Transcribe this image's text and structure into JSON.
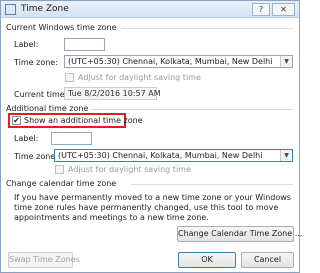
{
  "window": {
    "title": "Time Zone",
    "help_label": "?",
    "close_label": "✕"
  },
  "current": {
    "group_title": "Current Windows time zone",
    "label_label": "Label:",
    "label_value": "",
    "timezone_label": "Time zone:",
    "timezone_value": "(UTC+05:30) Chennai, Kolkata, Mumbai, New Delhi",
    "daylight_label": "Adjust for daylight saving time",
    "current_time_label": "Current time:",
    "current_time_value": "Tue 8/2/2016 10:57 AM"
  },
  "additional": {
    "group_title": "Additional time zone",
    "show_label": "Show an additional time zone",
    "show_checked": true,
    "label_label": "Label:",
    "label_value": "",
    "timezone_label": "Time zone:",
    "timezone_value": "(UTC+05:30) Chennai, Kolkata, Mumbai, New Delhi",
    "daylight_label": "Adjust for daylight saving time"
  },
  "change": {
    "group_title": "Change calendar time zone",
    "description": "If you have permanently moved to a new time zone or your Windows time zone rules have permanently changed, use this tool to move appointments and meetings to a new time zone.",
    "button_label": "Change Calendar Time Zone ..."
  },
  "footer": {
    "swap_label": "Swap Time Zones",
    "ok_label": "OK",
    "cancel_label": "Cancel"
  },
  "icons": {
    "checkmark": "✔",
    "dropdown": "▼"
  },
  "colors": {
    "highlight": "#e01e1e",
    "focus": "#3c7fb1"
  }
}
